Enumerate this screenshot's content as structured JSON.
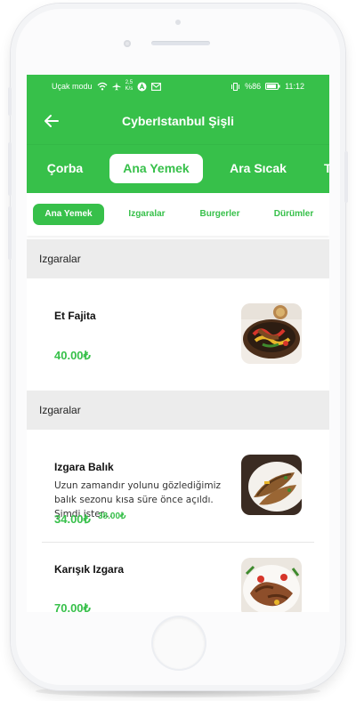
{
  "status_bar": {
    "carrier": "Uçak modu",
    "speed_value": "2,5",
    "speed_unit": "K/s",
    "battery": "%86",
    "time": "11:12"
  },
  "header": {
    "title": "CyberIstanbul Şişli"
  },
  "tabs": [
    {
      "label": "Çorba",
      "active": false
    },
    {
      "label": "Ana Yemek",
      "active": true
    },
    {
      "label": "Ara Sıcak",
      "active": false
    },
    {
      "label": "T",
      "active": false
    }
  ],
  "subcategories": [
    {
      "label": "Ana Yemek",
      "active": true
    },
    {
      "label": "Izgaralar",
      "active": false
    },
    {
      "label": "Burgerler",
      "active": false
    },
    {
      "label": "Dürümler",
      "active": false
    }
  ],
  "sections": [
    {
      "title": "Izgaralar",
      "items": [
        {
          "name": "Et Fajita",
          "description": "",
          "price": "40.00₺",
          "old_price": "",
          "image": "fajita-image"
        }
      ]
    },
    {
      "title": "Izgaralar",
      "items": [
        {
          "name": "Izgara Balık",
          "description": "Uzun zamandır yolunu gözlediğimiz balık sezonu kısa süre önce açıldı. Şimdi ister...",
          "price": "34.00₺",
          "old_price": "38.00₺",
          "image": "grilled-fish-image"
        },
        {
          "name": "Karışık Izgara",
          "description": "",
          "price": "70.00₺",
          "old_price": "",
          "image": "mixed-grill-image"
        }
      ]
    }
  ],
  "colors": {
    "accent": "#37c04a",
    "section_bg": "#ececec",
    "text": "#111111"
  },
  "icons": {
    "back": "arrow-left-icon",
    "wifi": "wifi-icon",
    "airplane": "airplane-icon",
    "battery": "battery-icon"
  }
}
